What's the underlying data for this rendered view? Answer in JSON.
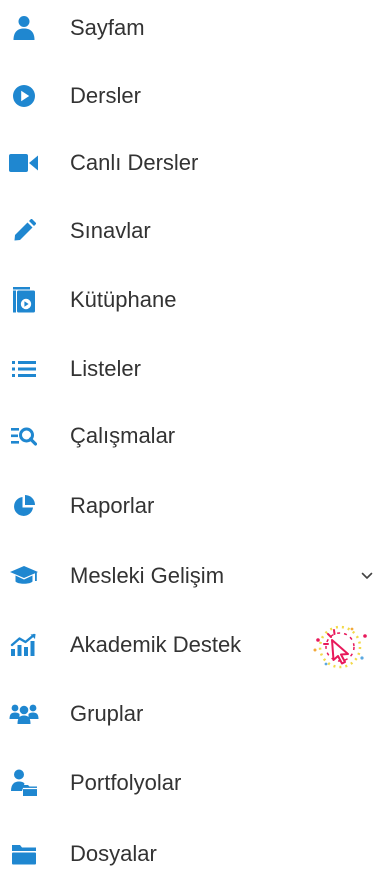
{
  "colors": {
    "icon": "#1f87d0",
    "text": "#333333",
    "chevron": "#444444",
    "badge_accent": "#e8195b"
  },
  "menu": {
    "items": [
      {
        "label": "Sayfam",
        "icon": "user-icon"
      },
      {
        "label": "Dersler",
        "icon": "play-circle-icon"
      },
      {
        "label": "Canlı Dersler",
        "icon": "video-camera-icon"
      },
      {
        "label": "Sınavlar",
        "icon": "pencil-icon"
      },
      {
        "label": "Kütüphane",
        "icon": "library-book-icon"
      },
      {
        "label": "Listeler",
        "icon": "list-icon"
      },
      {
        "label": "Çalışmalar",
        "icon": "search-list-icon"
      },
      {
        "label": "Raporlar",
        "icon": "pie-chart-icon"
      },
      {
        "label": "Mesleki Gelişim",
        "icon": "graduation-cap-icon",
        "expandable": true
      },
      {
        "label": "Akademik Destek",
        "icon": "growth-chart-icon",
        "badge": "click-cursor-icon"
      },
      {
        "label": "Gruplar",
        "icon": "users-group-icon"
      },
      {
        "label": "Portfolyolar",
        "icon": "user-folder-icon"
      },
      {
        "label": "Dosyalar",
        "icon": "folder-icon"
      }
    ]
  }
}
